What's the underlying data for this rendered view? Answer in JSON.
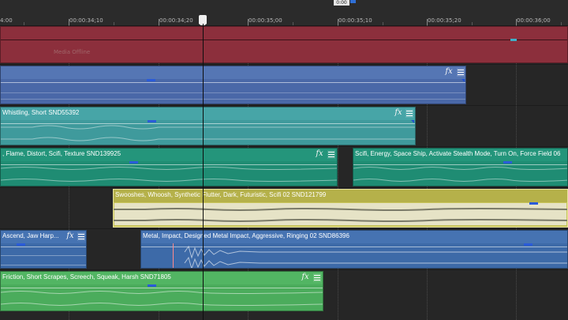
{
  "ruler": {
    "left_label": "4:00",
    "labels": [
      "00:00:34;10",
      "00:00:34;20",
      "00:00:35;00",
      "00:00:35;10",
      "00:00:35;20",
      "00:00:36;00"
    ],
    "playhead_time": "0:00"
  },
  "clips": {
    "media_offline": {
      "label": "Media Offline",
      "color": "#8c2f3c"
    },
    "blue_top": {
      "color": "#4a68a8"
    },
    "whistling": {
      "title": "Whistling, Short SND55392",
      "color": "#3f9a9c"
    },
    "flame": {
      "title": ", Flame, Distort, Scifi, Texture SND139925",
      "color": "#1f8c73"
    },
    "scifi_energy": {
      "title": "Scifi, Energy, Space Ship, Activate Stealth Mode, Turn On, Force Field 06",
      "color": "#1f8c73"
    },
    "swooshes": {
      "title": "Swooshes, Whoosh, Synthetic Flutter, Dark, Futuristic, Scifi 02 SND121799",
      "color": "#c8c45a"
    },
    "ascend": {
      "title": "Ascend, Jaw Harp...",
      "color": "#3d6aa8"
    },
    "metal": {
      "title": "Metal, Impact, Designed Metal Impact, Aggressive, Ringing 02 SND86396",
      "color": "#3d6aa8"
    },
    "friction": {
      "title": "Friction, Short Scrapes, Screech, Squeak, Harsh SND71805",
      "color": "#4bac5c"
    }
  },
  "icons": {
    "fx": "fx",
    "menu": "hamburger-menu-icon",
    "playhead": "playhead-marker-icon"
  }
}
